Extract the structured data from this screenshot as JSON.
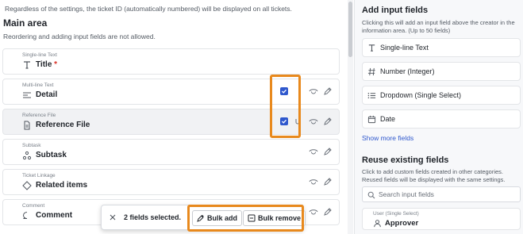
{
  "main": {
    "note": "Regardless of the settings, the ticket ID (automatically numbered) will be displayed on all tickets.",
    "section_title": "Main area",
    "section_subtitle": "Reordering and adding input fields are not allowed.",
    "required_mark": "*",
    "fields": [
      {
        "type": "Single-line Text",
        "name": "Title",
        "icon": "text-t-icon",
        "required": true
      },
      {
        "type": "Multi-line Text",
        "name": "Detail",
        "icon": "multiline-icon",
        "checked": true
      },
      {
        "type": "Reference File",
        "name": "Reference File",
        "icon": "file-icon",
        "checked": true
      },
      {
        "type": "Subtask",
        "name": "Subtask",
        "icon": "subtask-icon"
      },
      {
        "type": "Ticket Linkage",
        "name": "Related items",
        "icon": "link-tag-icon"
      },
      {
        "type": "Comment",
        "name": "Comment",
        "icon": "comment-icon"
      }
    ]
  },
  "bulk_bar": {
    "count_text": "2 fields selected.",
    "add_label": "Bulk add",
    "remove_label": "Bulk remove"
  },
  "sidebar": {
    "title": "Add input fields",
    "description": "Clicking this will add an input field above the creator in the information area. (Up to 50 fields)",
    "items": [
      {
        "label": "Single-line Text",
        "icon": "text-t-icon"
      },
      {
        "label": "Number (Integer)",
        "icon": "hash-icon"
      },
      {
        "label": "Dropdown (Single Select)",
        "icon": "list-icon"
      },
      {
        "label": "Date",
        "icon": "calendar-icon"
      }
    ],
    "show_more": "Show more fields",
    "reuse_title": "Reuse existing fields",
    "reuse_description": "Click to add custom fields created in other categories. Reused fields will be displayed with the same settings.",
    "search_placeholder": "Search input fields",
    "reuse_item": {
      "type": "User (Single Select)",
      "name": "Approver",
      "icon": "user-icon"
    }
  },
  "colors": {
    "accent": "#2f58cd",
    "highlight": "#e8891d",
    "required": "#d93025"
  }
}
